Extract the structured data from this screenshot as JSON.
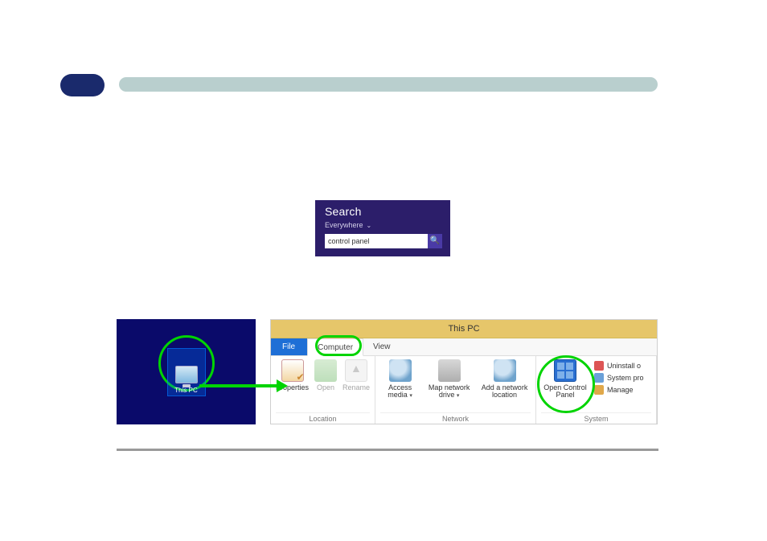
{
  "search": {
    "title": "Search",
    "scope": "Everywhere",
    "value": "control panel"
  },
  "desktop": {
    "icon_label": "This PC"
  },
  "explorer": {
    "window_title": "This PC",
    "tabs": {
      "file": "File",
      "computer": "Computer",
      "view": "View"
    },
    "groups": {
      "location": {
        "name": "Location",
        "properties": "Properties",
        "open": "Open",
        "rename": "Rename"
      },
      "network": {
        "name": "Network",
        "access_media": "Access media",
        "map_drive": "Map network drive",
        "add_location": "Add a network location"
      },
      "system": {
        "name": "System",
        "open_cp": "Open Control Panel",
        "uninstall": "Uninstall o",
        "sys_props": "System pro",
        "manage": "Manage"
      }
    }
  }
}
